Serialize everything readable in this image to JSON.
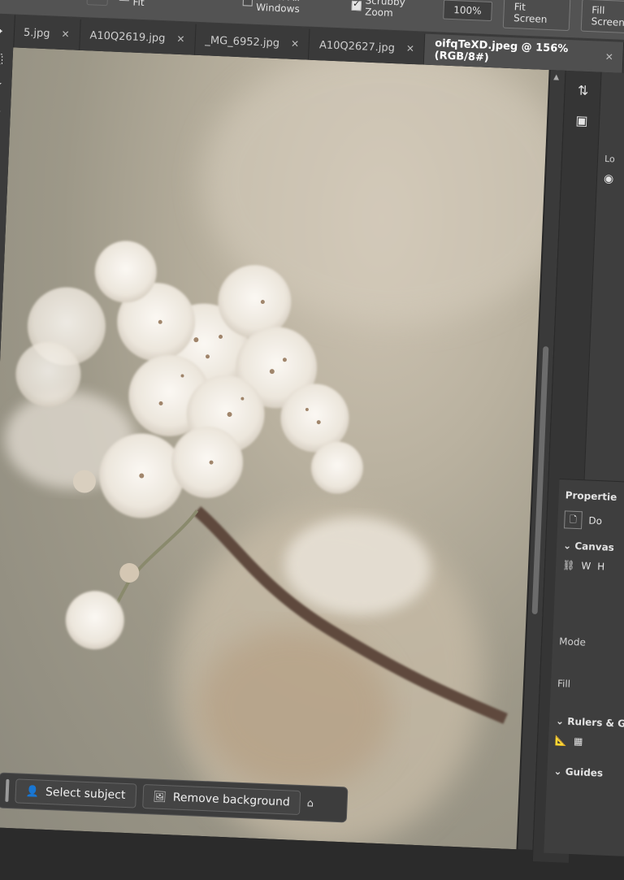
{
  "options_bar": {
    "resize_windows_label": "Resize Windows to Fit",
    "zoom_all_label": "Zoom All Windows",
    "scrubby_zoom_label": "Scrubby Zoom",
    "zoom_percent": "100%",
    "fit_screen_label": "Fit Screen",
    "fill_screen_label": "Fill Screen"
  },
  "tabs": [
    {
      "label": "5.jpg"
    },
    {
      "label": "A10Q2619.jpg"
    },
    {
      "label": "_MG_6952.jpg"
    },
    {
      "label": "A10Q2627.jpg"
    },
    {
      "label": "oifqTeXD.jpeg @ 156% (RGB/8#)"
    }
  ],
  "taskbar": {
    "select_subject_label": "Select subject",
    "remove_background_label": "Remove background"
  },
  "panel": {
    "properties_label": "Propertie",
    "doc_label": "Do",
    "canvas_label": "Canvas",
    "w_label": "W",
    "h_label": "H",
    "mode_label": "Mode",
    "fill_label": "Fill",
    "rulers_label": "Rulers & G",
    "guides_label": "Guides",
    "lo_label": "Lo"
  },
  "colors": {
    "accent": "#3b3b3b",
    "photo_bg": "#a8a393",
    "blossom": "#f3efe8",
    "stem": "#5e4a3c"
  }
}
